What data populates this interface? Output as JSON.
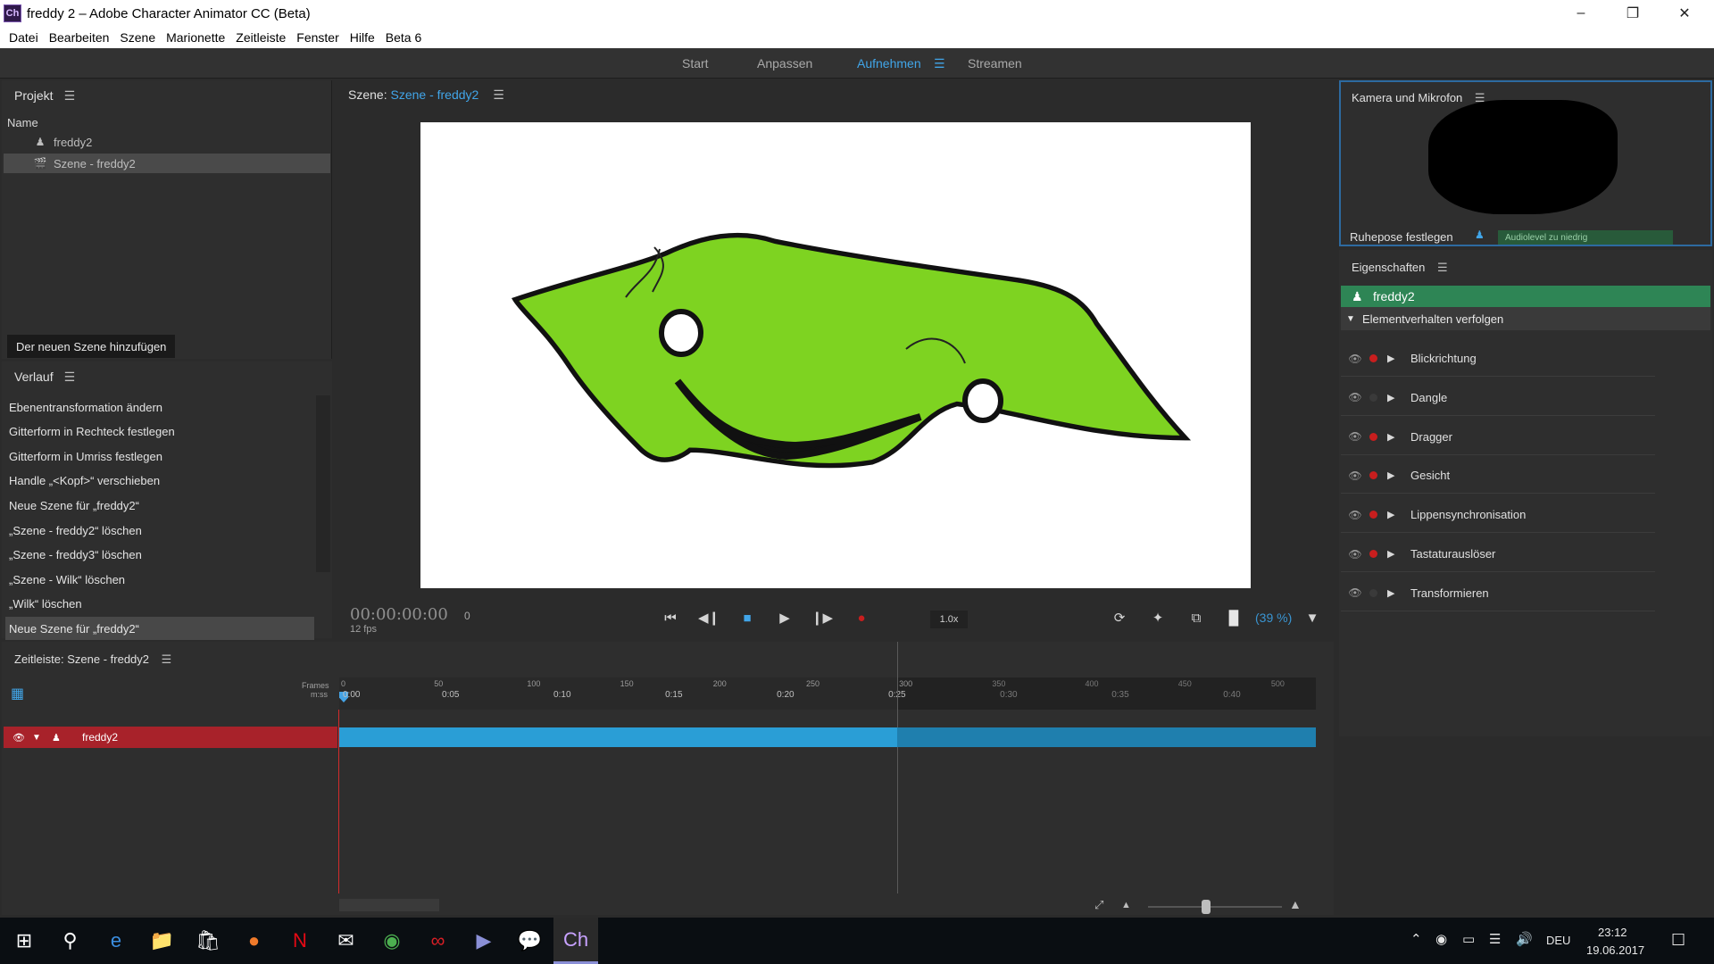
{
  "window": {
    "app_icon": "Ch",
    "title": "freddy 2 – Adobe Character Animator CC (Beta)"
  },
  "menu": [
    "Datei",
    "Bearbeiten",
    "Szene",
    "Marionette",
    "Zeitleiste",
    "Fenster",
    "Hilfe",
    "Beta 6"
  ],
  "workspaces": {
    "tabs": [
      "Start",
      "Anpassen",
      "Aufnehmen",
      "Streamen"
    ],
    "active": "Aufnehmen"
  },
  "project": {
    "title": "Projekt",
    "column": "Name",
    "items": [
      {
        "label": "freddy2",
        "icon": "puppet-icon",
        "selected": false
      },
      {
        "label": "Szene - freddy2",
        "icon": "scene-icon",
        "selected": true
      }
    ],
    "add_button": "Der neuen Szene hinzufügen"
  },
  "history": {
    "title": "Verlauf",
    "items": [
      "Ebenentransformation ändern",
      "Gitterform in Rechteck festlegen",
      "Gitterform in Umriss festlegen",
      "Handle „<Kopf>“ verschieben",
      "Neue Szene für „freddy2“",
      "„Szene - freddy2“ löschen",
      "„Szene - freddy3“ löschen",
      "„Szene - Wilk“ löschen",
      "„Wilk“ löschen",
      "Neue Szene für „freddy2“"
    ],
    "selected_index": 9
  },
  "scene": {
    "label": "Szene:",
    "name": "Szene - freddy2",
    "timecode": "00:00:00:00",
    "frame": "0",
    "fps": "12 fps",
    "speed": "1.0x",
    "zoom": "(39 %)"
  },
  "camera": {
    "title": "Kamera und Mikrofon",
    "rest_pose": "Ruhepose festlegen",
    "audio_status": "Audiolevel zu niedrig"
  },
  "properties": {
    "title": "Eigenschaften",
    "puppet": "freddy2",
    "section": "Elementverhalten verfolgen",
    "behaviors": [
      {
        "label": "Blickrichtung",
        "armed": true
      },
      {
        "label": "Dangle",
        "armed": false
      },
      {
        "label": "Dragger",
        "armed": true
      },
      {
        "label": "Gesicht",
        "armed": true
      },
      {
        "label": "Lippensynchronisation",
        "armed": true
      },
      {
        "label": "Tastaturauslöser",
        "armed": true
      },
      {
        "label": "Transformieren",
        "armed": false
      }
    ]
  },
  "timeline": {
    "title": "Zeitleiste: Szene - freddy2",
    "frames_label": "Frames",
    "time_label": "m:ss",
    "frame_ticks": [
      "0",
      "50",
      "100",
      "150",
      "200",
      "250",
      "300",
      "350",
      "400",
      "450",
      "500"
    ],
    "time_ticks": [
      "0:00",
      "0:05",
      "0:10",
      "0:15",
      "0:20",
      "0:25",
      "0:30",
      "0:35",
      "0:40"
    ],
    "track_name": "freddy2",
    "scene_end_frame": 300,
    "visible_frames": 525
  },
  "taskbar": {
    "apps": [
      "start-icon",
      "search-icon",
      "edge-icon",
      "explorer-icon",
      "store-icon",
      "firefox-icon",
      "netflix-icon",
      "mail-icon",
      "chrome-icon",
      "creative-cloud-icon",
      "media-player-icon",
      "twitch-icon",
      "character-animator-icon"
    ],
    "language": "DEU",
    "time": "23:12",
    "date": "19.06.2017"
  },
  "colors": {
    "accent": "#41a5e8",
    "puppet_green": "#2e8555",
    "track_red": "#a8222a",
    "track_blue": "#2a9ed6",
    "record_red": "#c81e1e",
    "character_green": "#7ed321"
  }
}
